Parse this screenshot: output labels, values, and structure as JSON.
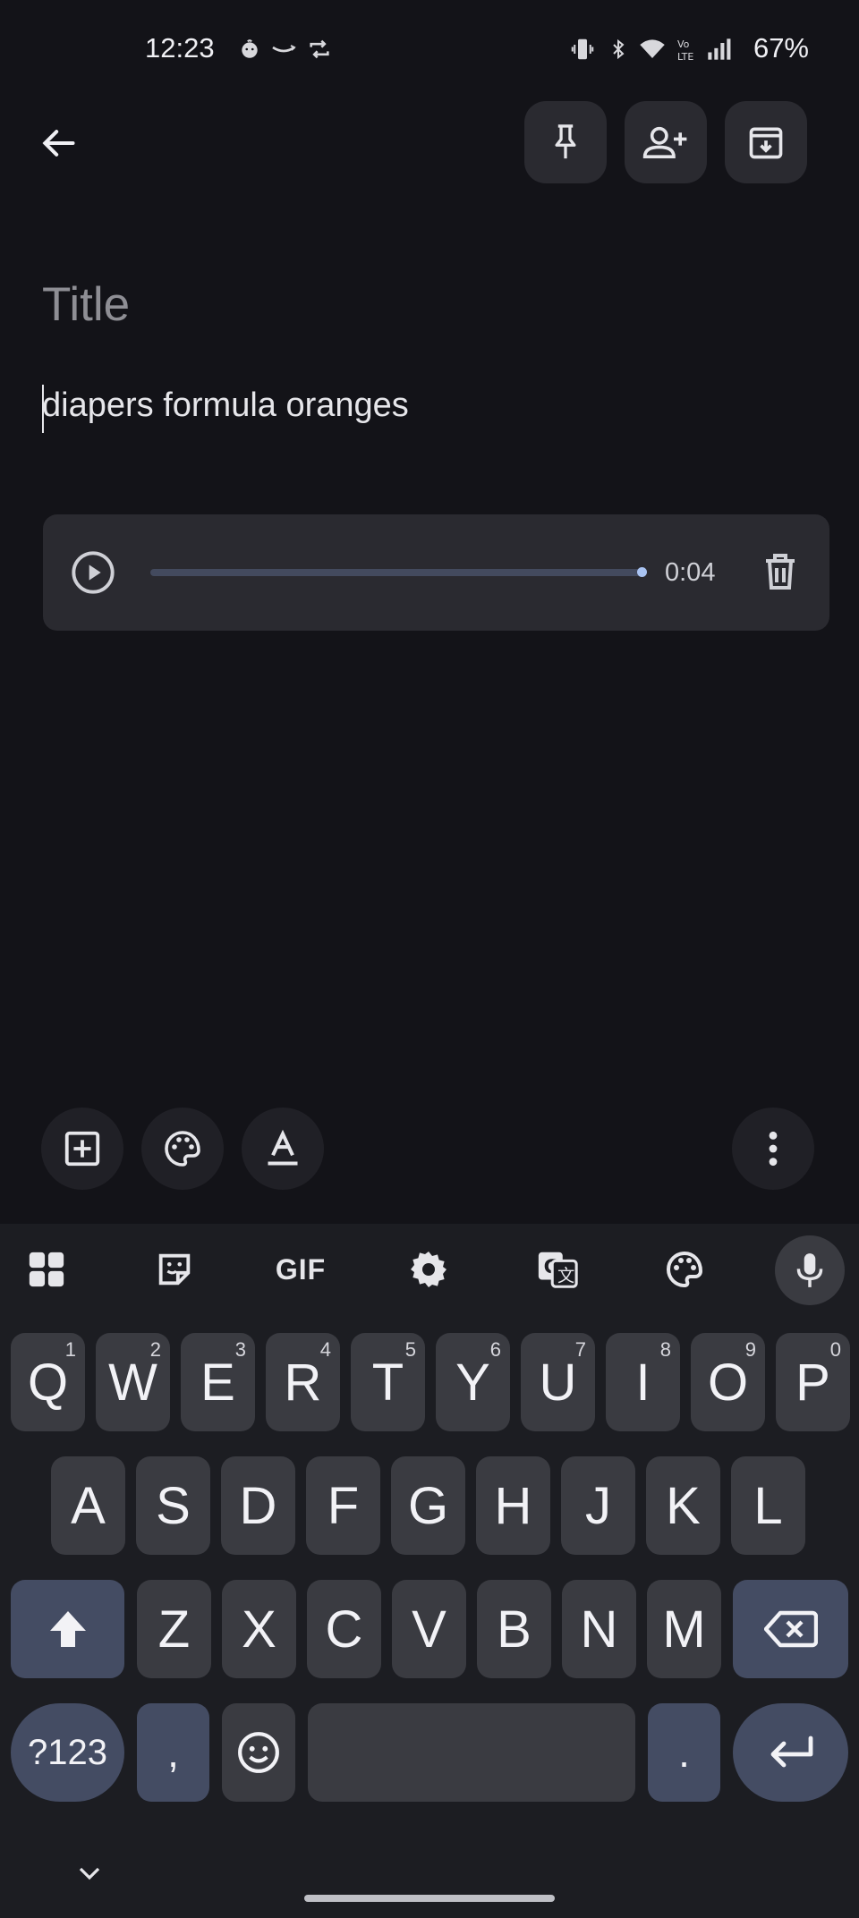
{
  "status_bar": {
    "time": "12:23",
    "battery": "67%",
    "icons": [
      "baby-icon",
      "amazon-icon",
      "sync-icon",
      "vibrate-icon",
      "bluetooth-icon",
      "wifi-icon",
      "volte-icon",
      "signal-icon"
    ]
  },
  "toolbar": {
    "icons": [
      "back-arrow-icon",
      "pin-icon",
      "add-collaborator-icon",
      "archive-icon"
    ]
  },
  "note": {
    "title_placeholder": "Title",
    "body_text": "diapers formula oranges"
  },
  "audio": {
    "duration": "0:04",
    "progress": 1.0,
    "icons": [
      "play-icon",
      "trash-icon"
    ]
  },
  "editor_tools": {
    "icons": [
      "add-box-icon",
      "palette-icon",
      "text-format-icon",
      "more-vert-icon"
    ]
  },
  "keyboard": {
    "suggestion_bar": {
      "gif_label": "GIF",
      "icons": [
        "apps-grid-icon",
        "sticker-icon",
        "settings-gear-icon",
        "translate-icon",
        "theme-palette-icon",
        "mic-icon"
      ]
    },
    "row1": [
      {
        "key": "Q",
        "num": "1"
      },
      {
        "key": "W",
        "num": "2"
      },
      {
        "key": "E",
        "num": "3"
      },
      {
        "key": "R",
        "num": "4"
      },
      {
        "key": "T",
        "num": "5"
      },
      {
        "key": "Y",
        "num": "6"
      },
      {
        "key": "U",
        "num": "7"
      },
      {
        "key": "I",
        "num": "8"
      },
      {
        "key": "O",
        "num": "9"
      },
      {
        "key": "P",
        "num": "0"
      }
    ],
    "row2": [
      "A",
      "S",
      "D",
      "F",
      "G",
      "H",
      "J",
      "K",
      "L"
    ],
    "row3": [
      "Z",
      "X",
      "C",
      "V",
      "B",
      "N",
      "M"
    ],
    "symbols_label": "?123",
    "comma": ",",
    "period": ".",
    "colors": {
      "background": "#1c1d22",
      "key": "#3a3b41",
      "modifier": "#444c63"
    }
  }
}
